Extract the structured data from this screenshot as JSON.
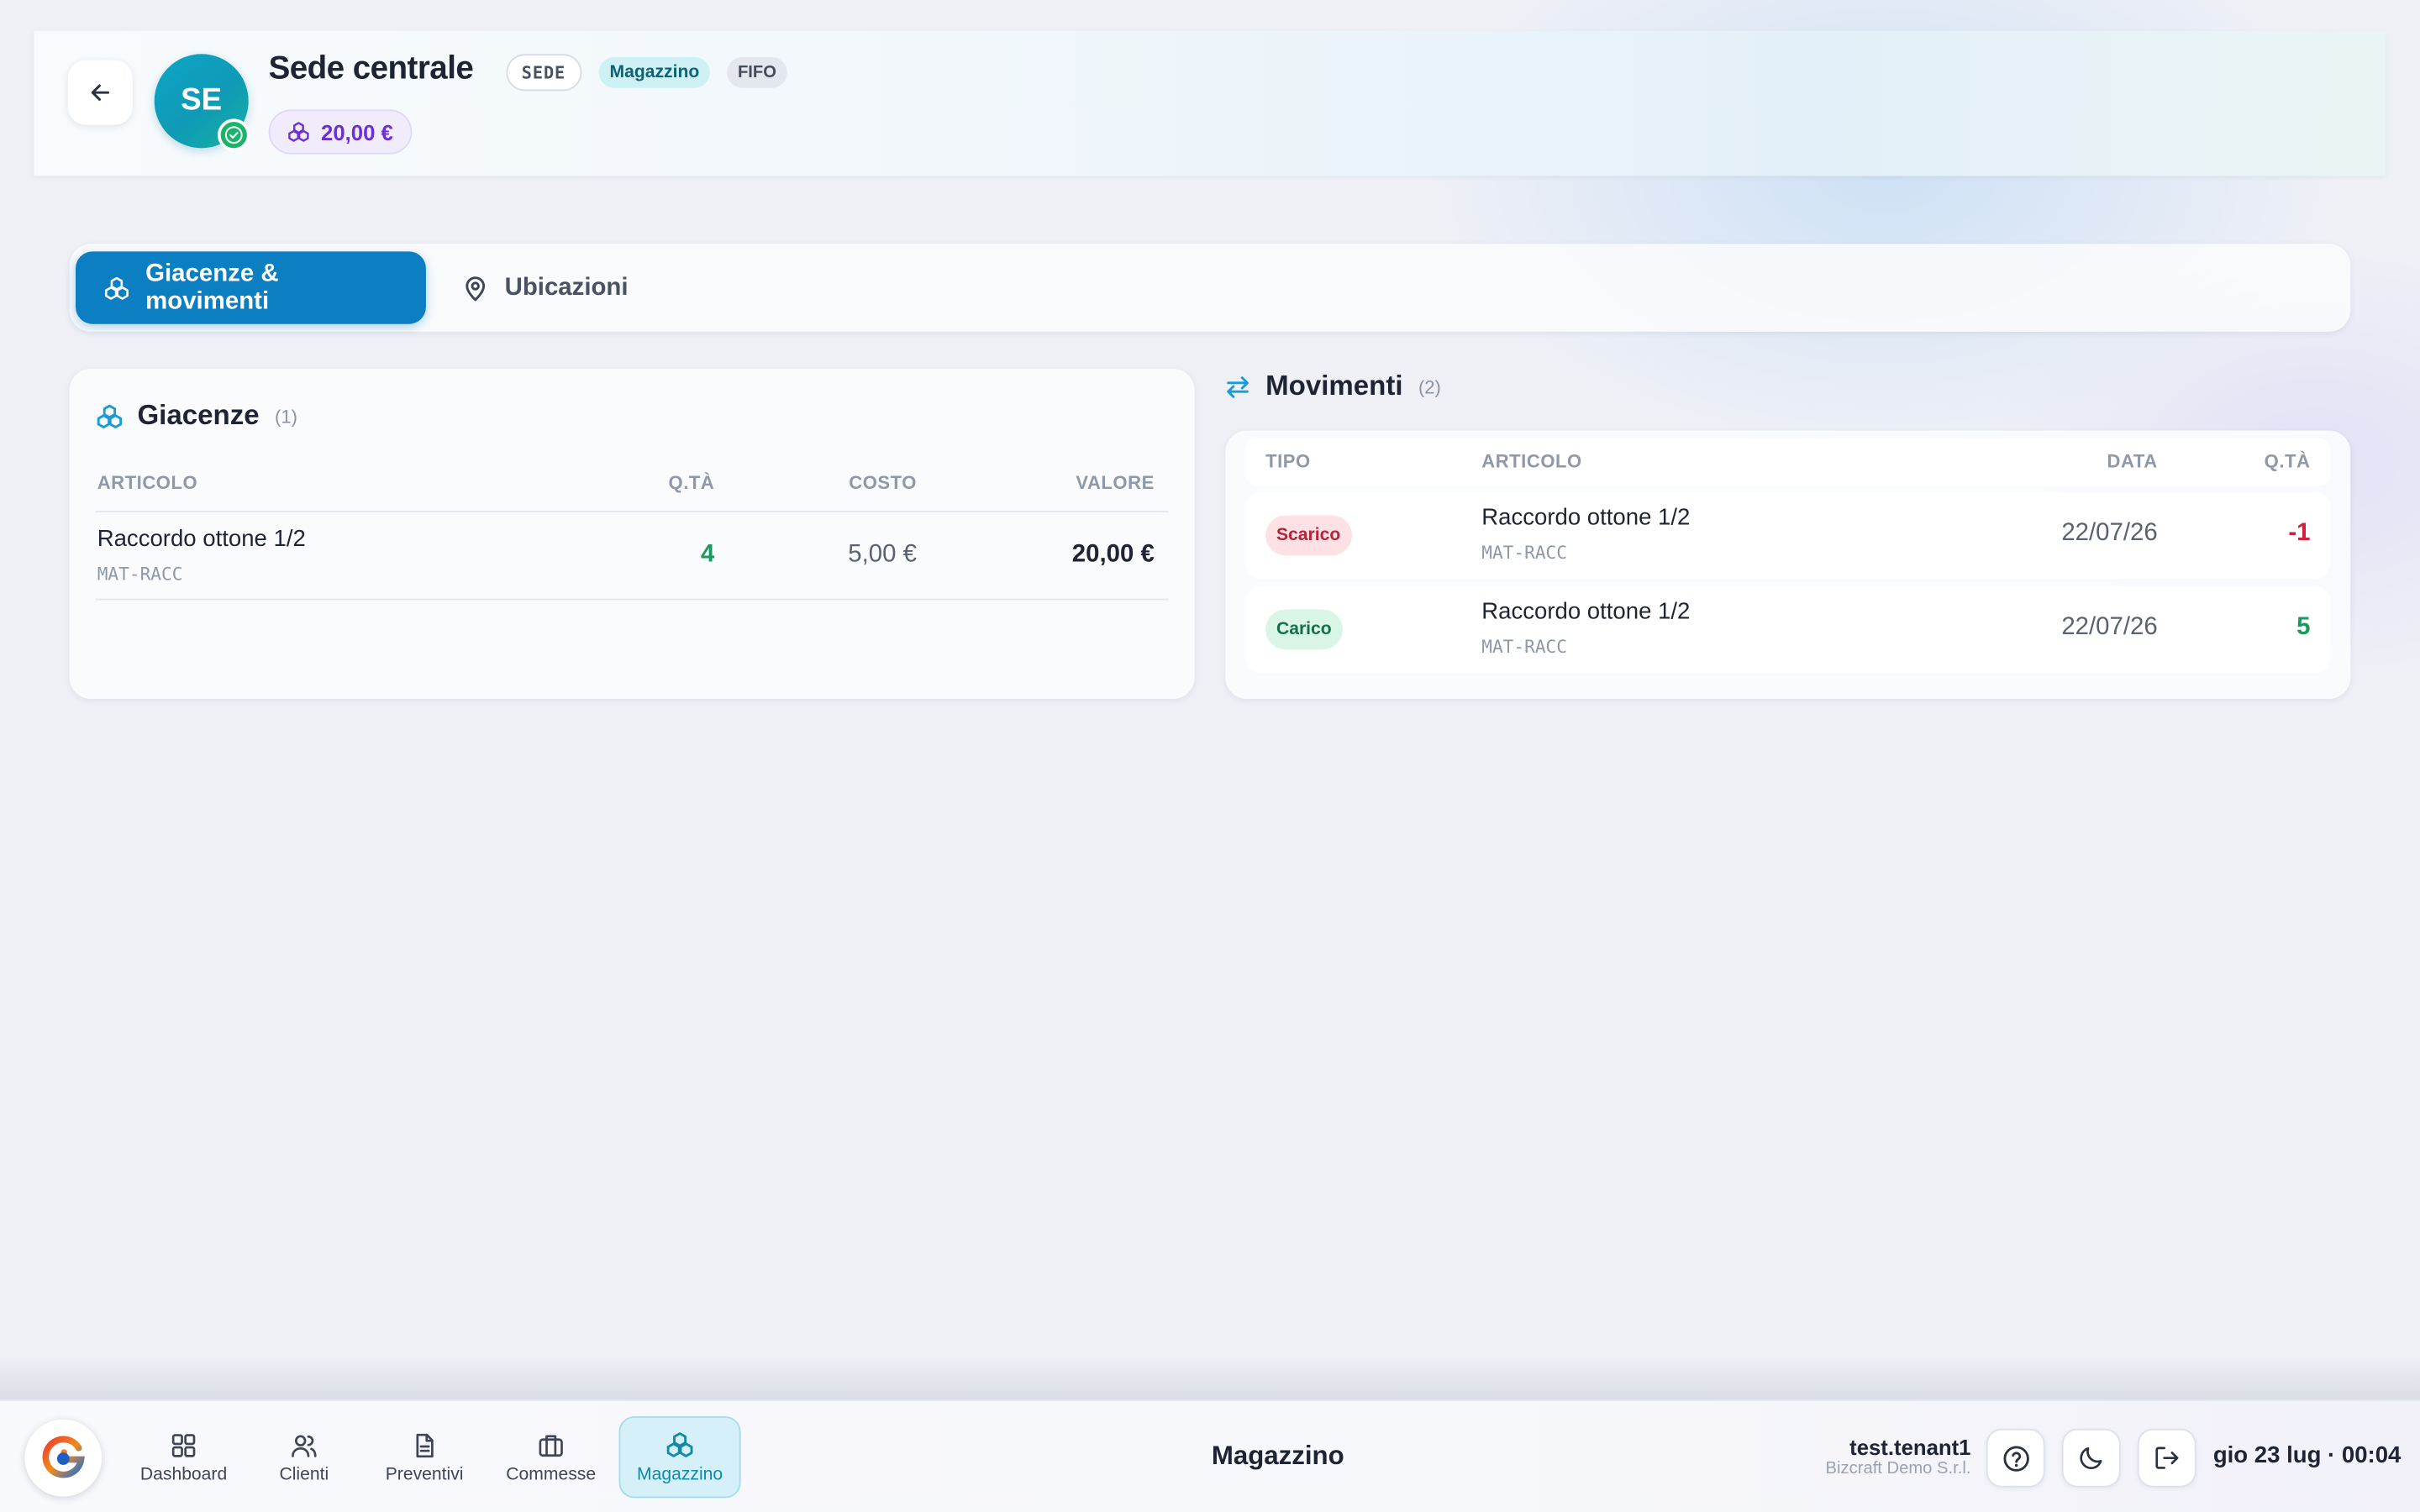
{
  "header": {
    "avatar_initials": "SE",
    "title": "Sede centrale",
    "badge_type": "SEDE",
    "badge_category": "Magazzino",
    "badge_method": "FIFO",
    "total_value": "20,00 €"
  },
  "tabs": [
    {
      "label": "Giacenze & movimenti",
      "icon": "boxes-icon",
      "active": true
    },
    {
      "label": "Ubicazioni",
      "icon": "map-pin-icon",
      "active": false
    }
  ],
  "giacenze": {
    "title": "Giacenze",
    "count": "(1)",
    "columns": [
      "ARTICOLO",
      "Q.TÀ",
      "COSTO",
      "VALORE"
    ],
    "rows": [
      {
        "name": "Raccordo ottone 1/2",
        "code": "MAT-RACC",
        "qty": "4",
        "cost": "5,00 €",
        "value": "20,00 €"
      }
    ]
  },
  "movimenti": {
    "title": "Movimenti",
    "count": "(2)",
    "columns": [
      "TIPO",
      "ARTICOLO",
      "DATA",
      "Q.TÀ"
    ],
    "rows": [
      {
        "type": "Scarico",
        "name": "Raccordo ottone 1/2",
        "code": "MAT-RACC",
        "date": "22/07/26",
        "qty": "-1"
      },
      {
        "type": "Carico",
        "name": "Raccordo ottone 1/2",
        "code": "MAT-RACC",
        "date": "22/07/26",
        "qty": "5"
      }
    ]
  },
  "bottom_nav": {
    "items": [
      {
        "label": "Dashboard",
        "icon": "grid-icon"
      },
      {
        "label": "Clienti",
        "icon": "users-icon"
      },
      {
        "label": "Preventivi",
        "icon": "document-icon"
      },
      {
        "label": "Commesse",
        "icon": "briefcase-icon"
      },
      {
        "label": "Magazzino",
        "icon": "boxes-icon",
        "active": true
      }
    ],
    "page_title": "Magazzino",
    "user": "test.tenant1",
    "organization": "Bizcraft Demo S.r.l.",
    "datetime": "gio 23 lug · 00:04"
  },
  "colors": {
    "accent": "#0b7fc2",
    "value_purple": "#6c2fd4",
    "positive": "#1a9a5c",
    "negative": "#d02040"
  }
}
